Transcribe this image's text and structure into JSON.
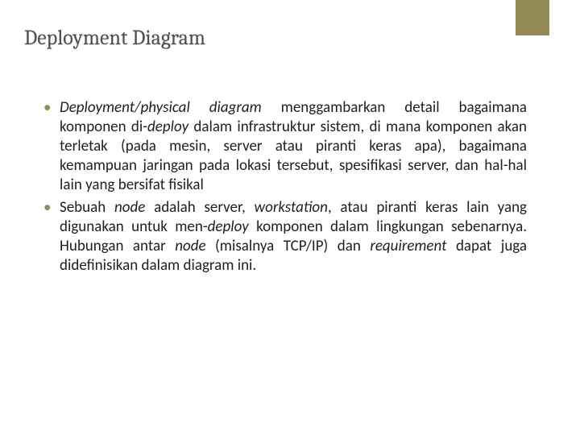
{
  "title": "Deployment Diagram",
  "bullets": [
    {
      "html": "<span class='it'>Deployment/physical diagram</span> menggambarkan detail bagaimana komponen di-<span class='it'>deploy</span> dalam infrastruktur sistem, di mana komponen akan terletak (pada mesin, server atau piranti keras apa), bagaimana kemampuan jaringan pada lokasi tersebut, spesifikasi server, dan hal-hal lain yang bersifat fisikal"
    },
    {
      "html": "Sebuah <span class='it'>node</span> adalah server, <span class='it'>workstation</span>, atau piranti keras lain yang digunakan untuk men-<span class='it'>deploy</span> komponen dalam lingkungan sebenarnya. Hubungan antar <span class='it'>node</span> (misalnya TCP/IP) dan <span class='it'>requirement</span> dapat juga didefinisikan dalam diagram ini."
    }
  ]
}
